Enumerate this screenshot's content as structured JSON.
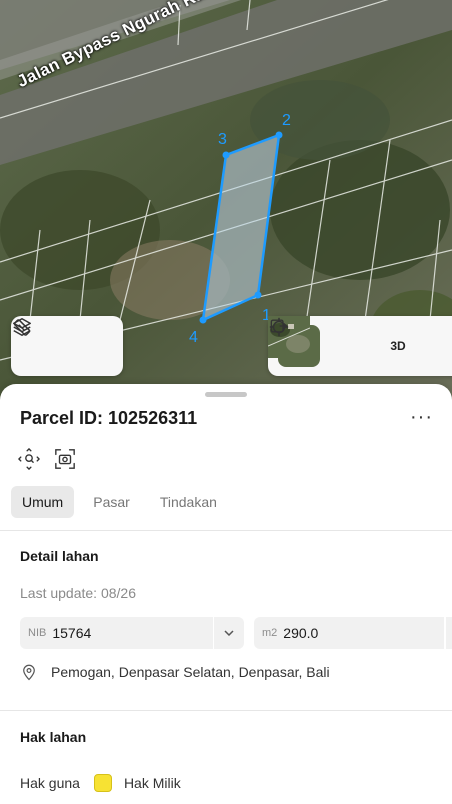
{
  "map": {
    "road_label": "Jalan Bypass Ngurah Rai",
    "vertex_labels": [
      "1",
      "2",
      "3",
      "4"
    ],
    "parcel_color": "#1e9bff"
  },
  "toolbar": {
    "layers_icon": "layers-icon",
    "measure_icon": "ruler-icon",
    "locate_icon": "crosshair-icon",
    "view_3d_label": "3D",
    "export_icon": "export-icon"
  },
  "sheet": {
    "title": "Parcel ID: 102526311",
    "more_label": "···",
    "tabs": [
      {
        "label": "Umum",
        "active": true
      },
      {
        "label": "Pasar",
        "active": false
      },
      {
        "label": "Tindakan",
        "active": false
      }
    ],
    "detail": {
      "heading": "Detail lahan",
      "last_update": "Last update: 08/26",
      "nib_label": "NIB",
      "nib_value": "15764",
      "area_label": "m2",
      "area_value": "290.0",
      "address": "Pemogan, Denpasar Selatan, Denpasar, Bali"
    },
    "rights": {
      "heading": "Hak lahan",
      "label": "Hak guna",
      "swatch_color": "#f7e233",
      "value": "Hak Milik"
    }
  }
}
